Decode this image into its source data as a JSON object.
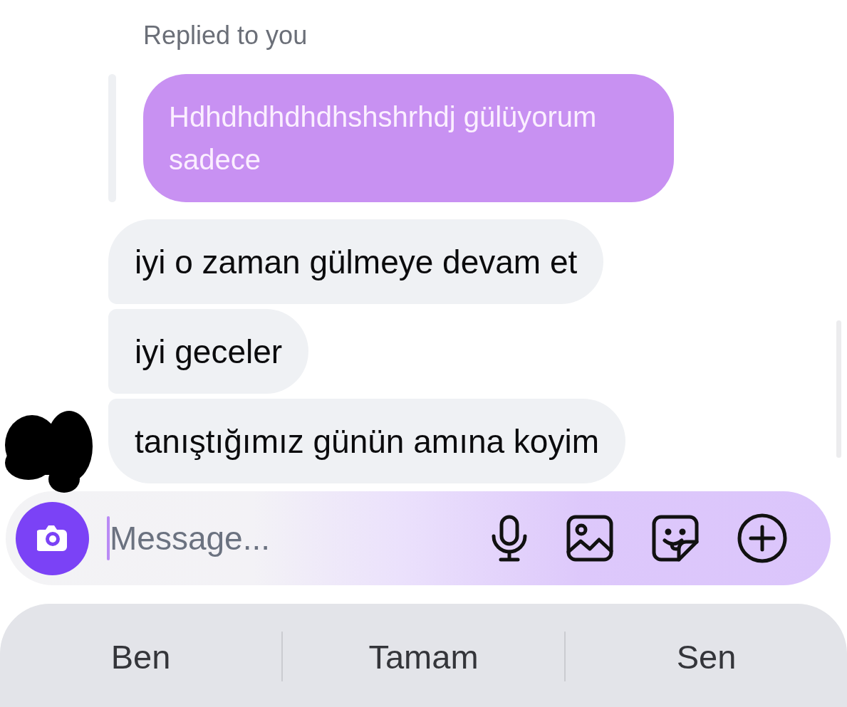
{
  "reply_header": {
    "label": "Replied to you"
  },
  "quoted_message": {
    "text": "Hdhdhdhdhdhshshrhdj gülüyorum sadece"
  },
  "messages": [
    {
      "text": "iyi o zaman gülmeye devam et"
    },
    {
      "text": "iyi geceler"
    },
    {
      "text": "tanıştığımız günün amına koyim"
    }
  ],
  "composer": {
    "placeholder": "Message..."
  },
  "keyboard_suggestions": [
    {
      "label": "Ben"
    },
    {
      "label": "Tamam"
    },
    {
      "label": "Sen"
    }
  ]
}
